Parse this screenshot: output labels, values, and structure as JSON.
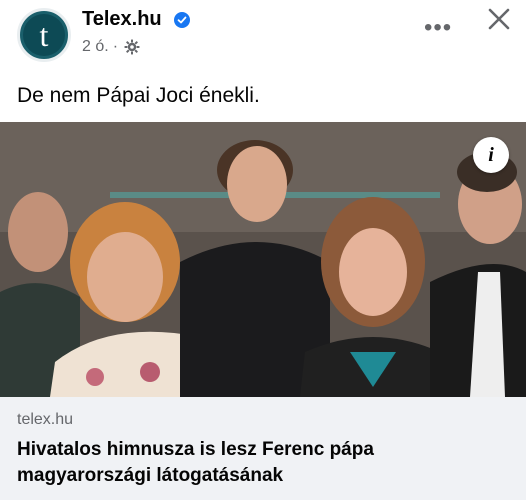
{
  "post": {
    "page_name": "Telex.hu",
    "time": "2 ó.",
    "separator": "·",
    "avatar_letter": "t",
    "caption": "De nem Pápai Joci énekli.",
    "more_label": "•••"
  },
  "link": {
    "domain": "telex.hu",
    "headline": "Hivatalos himnusza is lesz Ferenc pápa magyarországi látogatásának",
    "info_label": "i"
  },
  "colors": {
    "verified": "#1877f2",
    "secondary_text": "#65676b",
    "card_bg": "#f0f2f5"
  },
  "icons": [
    "verified-badge-icon",
    "gear-icon",
    "more-icon",
    "close-icon",
    "info-icon"
  ]
}
